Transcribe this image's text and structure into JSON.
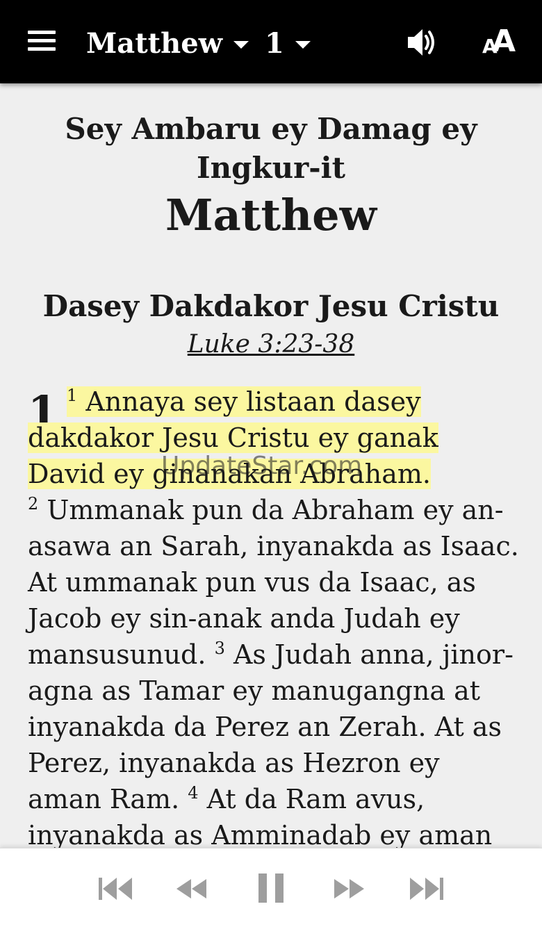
{
  "topbar": {
    "book": "Matthew",
    "chapter": "1",
    "menu_icon": "hamburger-menu-icon",
    "audio_icon": "speaker-icon",
    "text_size_icon": "text-size-icon",
    "text_size_small": "A",
    "text_size_big": "A"
  },
  "header": {
    "line1": "Sey Ambaru ey Damag ey",
    "line2": "Ingkur-it",
    "book_title": "Matthew"
  },
  "section": {
    "title": "Dasey Dakdakor Jesu Cristu",
    "cross_reference": "Luke 3:23-38"
  },
  "chapter_number": "1",
  "verses": [
    {
      "num": "1",
      "text": "Annaya sey listaan dasey dakdakor Jesu Cristu ey ganak David ey ginanakan Abraham.",
      "highlighted": true
    },
    {
      "num": "2",
      "text": "Ummanak pun da Abraham ey an-asawa an Sarah, inyanakda as Isaac. At ummanak pun vus da Isaac, as Jacob ey sin-anak anda Judah ey mansusunud.",
      "highlighted": false
    },
    {
      "num": "3",
      "text": "As Judah anna, jinor-agna as Tamar ey manugangna at inyanakda da Perez an Zerah. At as Perez, inyanakda as Hezron ey aman Ram.",
      "highlighted": false
    },
    {
      "num": "4",
      "text": "At da Ram avus, inyanakda as Amminadab ey aman",
      "highlighted": false
    }
  ],
  "watermark": "UpdateStar.com",
  "colors": {
    "topbar_bg": "#000000",
    "page_bg": "#efefef",
    "highlight": "#fbf7a0",
    "player_icon": "#9e9e9e"
  },
  "player": {
    "buttons": [
      "skip-previous-icon",
      "rewind-icon",
      "pause-icon",
      "fast-forward-icon",
      "skip-next-icon"
    ]
  }
}
